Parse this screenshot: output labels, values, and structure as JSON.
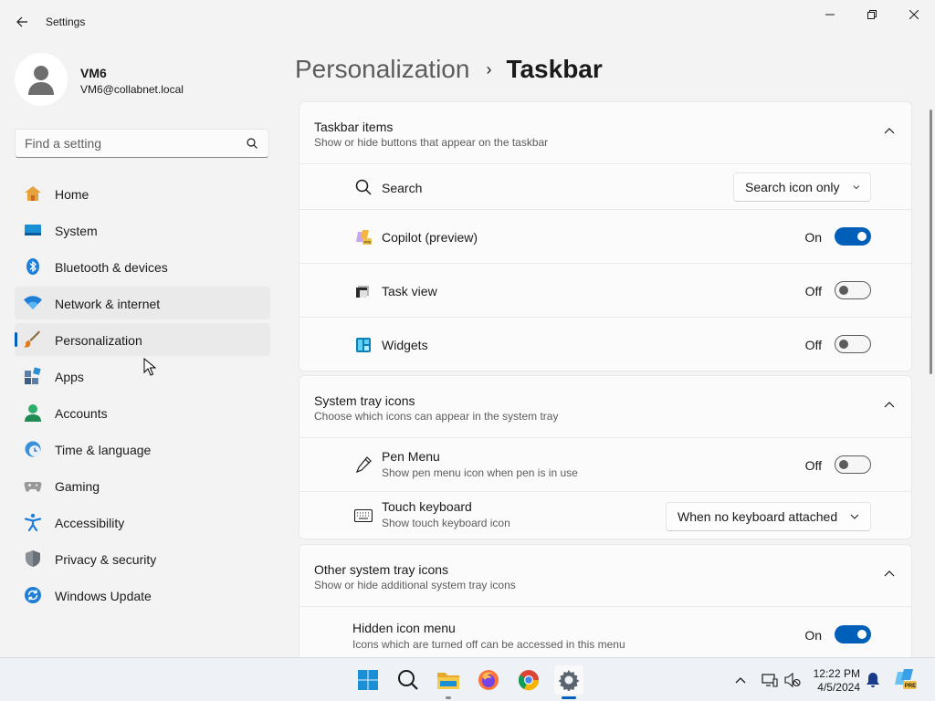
{
  "window": {
    "title": "Settings"
  },
  "profile": {
    "name": "VM6",
    "email": "VM6@collabnet.local"
  },
  "search": {
    "placeholder": "Find a setting"
  },
  "nav": {
    "items": [
      {
        "label": "Home",
        "icon": "home-icon"
      },
      {
        "label": "System",
        "icon": "system-icon"
      },
      {
        "label": "Bluetooth & devices",
        "icon": "bluetooth-icon"
      },
      {
        "label": "Network & internet",
        "icon": "wifi-icon"
      },
      {
        "label": "Personalization",
        "icon": "brush-icon"
      },
      {
        "label": "Apps",
        "icon": "apps-icon"
      },
      {
        "label": "Accounts",
        "icon": "account-icon"
      },
      {
        "label": "Time & language",
        "icon": "clock-globe-icon"
      },
      {
        "label": "Gaming",
        "icon": "gamepad-icon"
      },
      {
        "label": "Accessibility",
        "icon": "accessibility-icon"
      },
      {
        "label": "Privacy & security",
        "icon": "shield-icon"
      },
      {
        "label": "Windows Update",
        "icon": "update-icon"
      }
    ]
  },
  "breadcrumb": {
    "parent": "Personalization",
    "separator": "›",
    "current": "Taskbar"
  },
  "taskbar_items": {
    "title": "Taskbar items",
    "subtitle": "Show or hide buttons that appear on the taskbar",
    "search": {
      "label": "Search",
      "value": "Search icon only"
    },
    "copilot": {
      "label": "Copilot (preview)",
      "state": "On"
    },
    "task_view": {
      "label": "Task view",
      "state": "Off"
    },
    "widgets": {
      "label": "Widgets",
      "state": "Off"
    }
  },
  "system_tray": {
    "title": "System tray icons",
    "subtitle": "Choose which icons can appear in the system tray",
    "pen_menu": {
      "label": "Pen Menu",
      "description": "Show pen menu icon when pen is in use",
      "state": "Off"
    },
    "touch_keyboard": {
      "label": "Touch keyboard",
      "description": "Show touch keyboard icon",
      "value": "When no keyboard attached"
    }
  },
  "other_tray": {
    "title": "Other system tray icons",
    "subtitle": "Show or hide additional system tray icons",
    "hidden_menu": {
      "label": "Hidden icon menu",
      "description": "Icons which are turned off can be accessed in this menu",
      "state": "On"
    }
  },
  "taskbar": {
    "time": "12:22 PM",
    "date": "4/5/2024",
    "pre_badge": "PRE"
  },
  "colors": {
    "accent": "#005fb8",
    "background": "#f3f3f3",
    "card": "#fbfbfb"
  }
}
